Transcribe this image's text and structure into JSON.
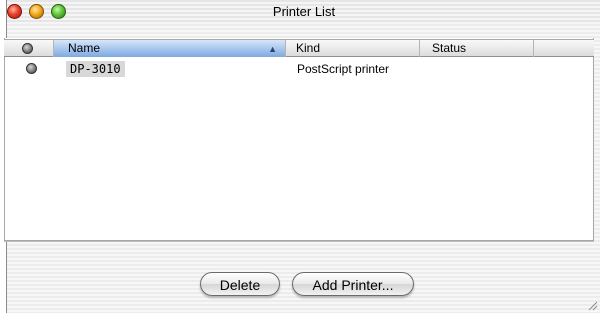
{
  "window": {
    "title": "Printer List"
  },
  "table": {
    "columns": {
      "name": "Name",
      "kind": "Kind",
      "status": "Status"
    },
    "sort_indicator": "▲",
    "rows": [
      {
        "name": "DP-3010",
        "kind": "PostScript printer",
        "status": ""
      }
    ]
  },
  "buttons": {
    "delete": "Delete",
    "add_printer": "Add Printer..."
  },
  "colors": {
    "close": "#e8402a",
    "minimize": "#f3a81a",
    "zoom": "#5fc43a",
    "selected_header": "#7da9e0"
  },
  "icons": {
    "close": "close-icon",
    "minimize": "minimize-icon",
    "zoom": "zoom-icon",
    "status_column": "status-dot-icon",
    "row_status": "status-dot-icon",
    "resize": "resize-grip-icon"
  }
}
